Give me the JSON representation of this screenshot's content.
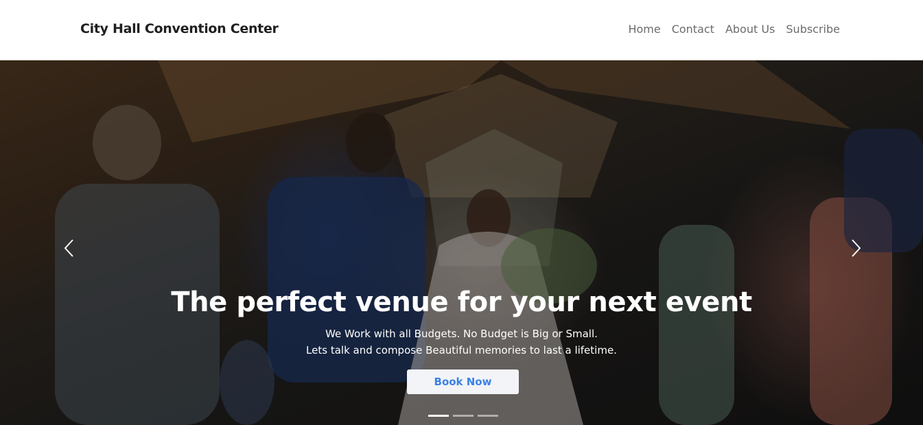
{
  "navbar": {
    "brand": "City Hall Convention Center",
    "links": [
      {
        "label": "Home"
      },
      {
        "label": "Contact"
      },
      {
        "label": "About Us"
      },
      {
        "label": "Subscribe"
      }
    ]
  },
  "hero": {
    "headline": "The perfect venue for your next event",
    "line1": "We Work with all Budgets. No Budget is Big or Small.",
    "line2": "Lets talk and compose Beautiful memories to last a lifetime.",
    "button_label": "Book Now",
    "prev_icon": "chevron-left-icon",
    "next_icon": "chevron-right-icon",
    "slides": 3,
    "active_slide": 1
  },
  "colors": {
    "button_text": "#3b82e6",
    "button_bg": "#f2f4f7"
  }
}
